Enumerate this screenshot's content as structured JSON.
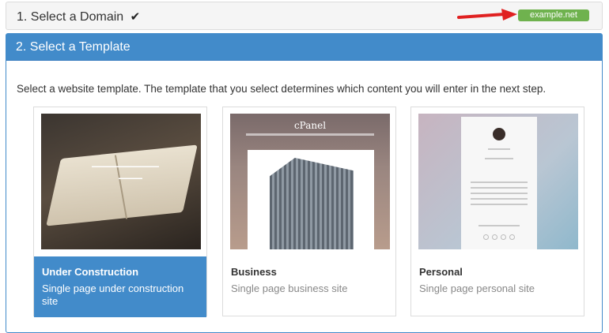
{
  "step1": {
    "title": "1. Select a Domain",
    "check_glyph": "✔",
    "domain": "example.net"
  },
  "step2": {
    "title": "2. Select a Template",
    "intro": "Select a website template. The template that you select determines which content you will enter in the next step."
  },
  "templates": [
    {
      "name": "Under Construction",
      "desc": "Single page under construction site",
      "selected": true
    },
    {
      "name": "Business",
      "desc": "Single page business site",
      "selected": false,
      "preview_brand": "cPanel"
    },
    {
      "name": "Personal",
      "desc": "Single page personal site",
      "selected": false
    }
  ],
  "colors": {
    "accent": "#428bca",
    "badge": "#6fb24e",
    "arrow": "#e02020"
  },
  "icons": {
    "check": "check-icon",
    "arrow": "arrow-icon"
  }
}
